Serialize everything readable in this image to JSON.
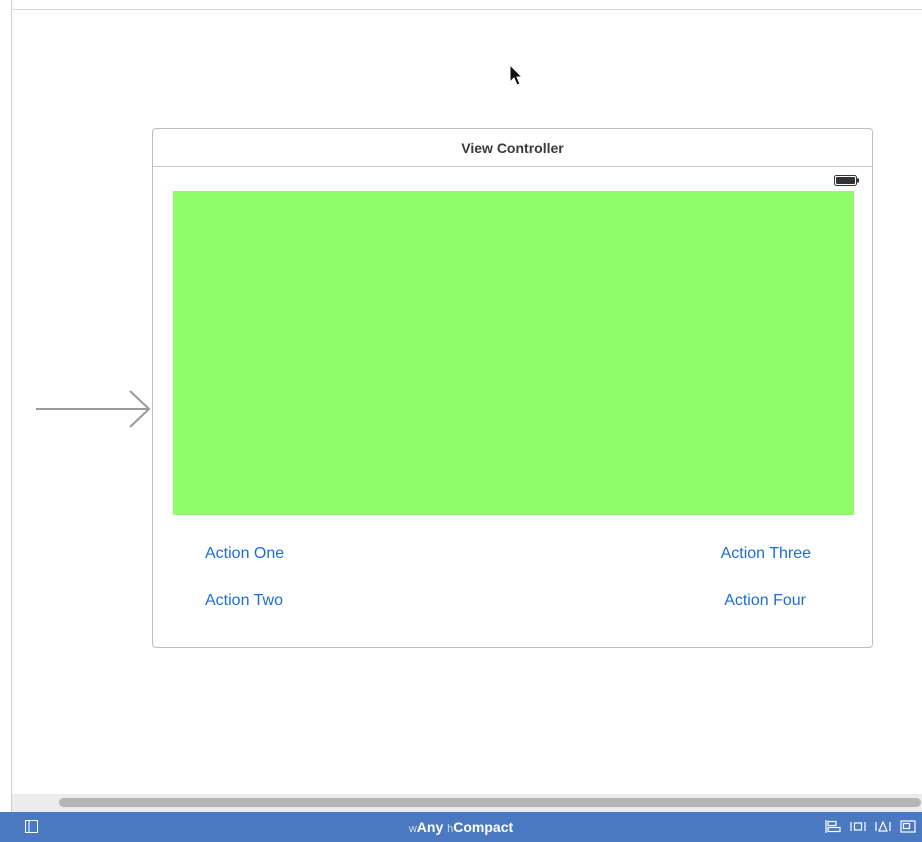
{
  "scene": {
    "title": "View Controller",
    "content_color": "#8efd67",
    "actions": {
      "one": "Action One",
      "two": "Action Two",
      "three": "Action Three",
      "four": "Action Four"
    }
  },
  "bottom_bar": {
    "width_prefix": "w",
    "width_value": "Any",
    "height_prefix": "h",
    "height_value": "Compact",
    "icons": [
      "sidebar-toggle-icon",
      "align-icon",
      "pin-icon",
      "resolve-issues-icon",
      "resizing-icon"
    ]
  },
  "colors": {
    "accent_blue": "#1a6fd6",
    "bar_blue": "#4a79c1"
  }
}
